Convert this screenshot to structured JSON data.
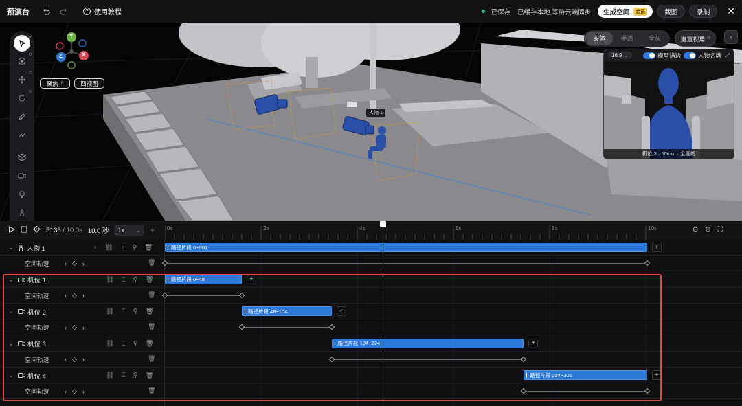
{
  "topbar": {
    "title": "预演台",
    "tutorial": "使用教程",
    "saved": "已保存",
    "sync_status": "已缓存本地,等待云端同步",
    "generate_space": "生成空间",
    "vip_badge": "会员",
    "screenshot": "截图",
    "record": "录制"
  },
  "viewport": {
    "gizmo": {
      "y": "Y",
      "z": "Z",
      "x": "X"
    },
    "focus_label": "聚焦",
    "focus_key": "F",
    "four_view": "四视图",
    "modes": [
      "实体",
      "半透",
      "全灰"
    ],
    "active_mode": "实体",
    "reset_view": "重置视角",
    "reset_key": "H",
    "character_tag": "人物 1",
    "tool_keys": {
      "move": "G",
      "rotate": "R",
      "orbit": "Q",
      "select": "W"
    },
    "preview": {
      "ratio": "16:9",
      "toggle_outline": "模型描边",
      "toggle_nameplate": "人物名牌",
      "caption": "机位 3 · 50mm · 全画幅"
    }
  },
  "timeline": {
    "frame": "F136",
    "time": "10.0s",
    "duration": "10.0 秒",
    "speed": "1x",
    "ticks": [
      "0s",
      "2s",
      "4s",
      "6s",
      "8s",
      "10s"
    ],
    "tracks": [
      {
        "name": "人物 1",
        "sub": "空间轨迹",
        "clip": "路径片段 0~301",
        "clip_start": 0,
        "clip_end": 301
      },
      {
        "name": "机位 1",
        "sub": "空间轨迹",
        "clip": "路径片段 0~48",
        "clip_start": 0,
        "clip_end": 48
      },
      {
        "name": "机位 2",
        "sub": "空间轨迹",
        "clip": "路径片段 48~104",
        "clip_start": 48,
        "clip_end": 104
      },
      {
        "name": "机位 3",
        "sub": "空间轨迹",
        "clip": "路径片段 104~224",
        "clip_start": 104,
        "clip_end": 224
      },
      {
        "name": "机位 4",
        "sub": "空间轨迹",
        "clip": "路径片段 224~301",
        "clip_start": 224,
        "clip_end": 301
      }
    ],
    "total_frames": 301,
    "playhead_frame": 136
  },
  "colors": {
    "accent": "#2c78d8",
    "highlight": "#e0473f",
    "saved": "#35c07a"
  }
}
